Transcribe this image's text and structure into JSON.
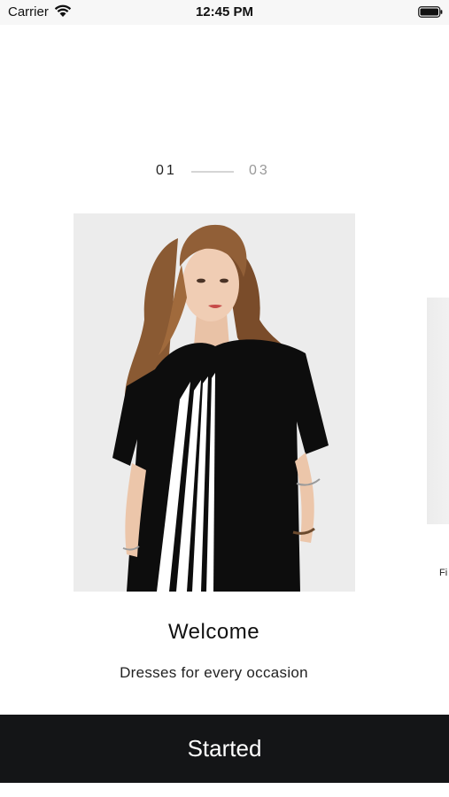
{
  "status_bar": {
    "carrier": "Carrier",
    "time": "12:45 PM",
    "wifi_icon": "wifi-icon",
    "battery_icon": "battery-icon"
  },
  "pager": {
    "current": "01",
    "total": "03"
  },
  "slide": {
    "image": "model-black-dress-photo",
    "title": "Welcome",
    "subtitle": "Dresses for every occasion"
  },
  "next_slide": {
    "caption_fragment": "Fi"
  },
  "button": {
    "label": "Started"
  },
  "colors": {
    "button_bg": "#141517",
    "button_text": "#ffffff",
    "pager_active": "#222222",
    "pager_inactive": "#999999",
    "image_bg": "#ececec"
  }
}
